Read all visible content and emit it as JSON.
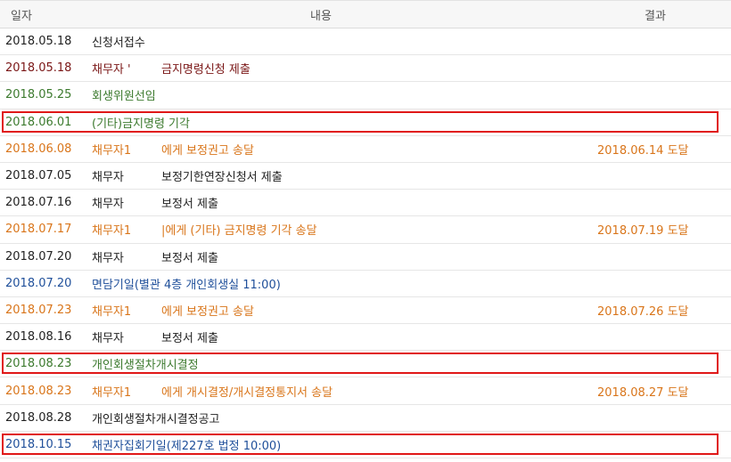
{
  "header": {
    "date": "일자",
    "content": "내용",
    "result": "결과"
  },
  "rows": [
    {
      "date": "2018.05.18",
      "party": "",
      "text": "신청서접수",
      "result": "",
      "color": "#222222",
      "partyColor": "#222222",
      "highlight": false
    },
    {
      "date": "2018.05.18",
      "party": "채무자 '",
      "text": "금지명령신청 제출",
      "result": "",
      "color": "#7a1616",
      "partyColor": "#7a1616",
      "highlight": false
    },
    {
      "date": "2018.05.25",
      "party": "",
      "text": "회생위원선임",
      "result": "",
      "color": "#3c7a2e",
      "partyColor": "#3c7a2e",
      "highlight": false
    },
    {
      "date": "2018.06.01",
      "party": "",
      "text": "(기타)금지명령 기각",
      "result": "",
      "color": "#3c7a2e",
      "partyColor": "#3c7a2e",
      "highlight": true
    },
    {
      "date": "2018.06.08",
      "party": "채무자1",
      "text": "에게 보정권고 송달",
      "result": "2018.06.14 도달",
      "color": "#d9751a",
      "partyColor": "#d9751a",
      "highlight": false
    },
    {
      "date": "2018.07.05",
      "party": "채무자",
      "text": "보정기한연장신청서 제출",
      "result": "",
      "color": "#222222",
      "partyColor": "#222222",
      "highlight": false
    },
    {
      "date": "2018.07.16",
      "party": "채무자",
      "text": "보정서 제출",
      "result": "",
      "color": "#222222",
      "partyColor": "#222222",
      "highlight": false
    },
    {
      "date": "2018.07.17",
      "party": "채무자1",
      "text": "|에게 (기타) 금지명령 기각 송달",
      "result": "2018.07.19 도달",
      "color": "#d9751a",
      "partyColor": "#d9751a",
      "highlight": false
    },
    {
      "date": "2018.07.20",
      "party": "채무자",
      "text": "보정서 제출",
      "result": "",
      "color": "#222222",
      "partyColor": "#222222",
      "highlight": false
    },
    {
      "date": "2018.07.20",
      "party": "",
      "text": "면담기일(별관 4층 개인회생실 11:00)",
      "result": "",
      "color": "#1f4f9a",
      "partyColor": "#1f4f9a",
      "highlight": false
    },
    {
      "date": "2018.07.23",
      "party": "채무자1",
      "text": "에게 보정권고 송달",
      "result": "2018.07.26 도달",
      "color": "#d9751a",
      "partyColor": "#d9751a",
      "highlight": false
    },
    {
      "date": "2018.08.16",
      "party": "채무자",
      "text": "보정서 제출",
      "result": "",
      "color": "#222222",
      "partyColor": "#222222",
      "highlight": false
    },
    {
      "date": "2018.08.23",
      "party": "",
      "text": "개인회생절차개시결정",
      "result": "",
      "color": "#3c7a2e",
      "partyColor": "#3c7a2e",
      "highlight": true
    },
    {
      "date": "2018.08.23",
      "party": "채무자1",
      "text": "에게 개시결정/개시결정통지서 송달",
      "result": "2018.08.27 도달",
      "color": "#d9751a",
      "partyColor": "#d9751a",
      "highlight": false
    },
    {
      "date": "2018.08.28",
      "party": "",
      "text": "개인회생절차개시결정공고",
      "result": "",
      "color": "#222222",
      "partyColor": "#222222",
      "highlight": false
    },
    {
      "date": "2018.10.15",
      "party": "",
      "text": "채권자집회기일(제227호 법정 10:00)",
      "result": "",
      "color": "#1f4f9a",
      "partyColor": "#1f4f9a",
      "highlight": true
    }
  ]
}
